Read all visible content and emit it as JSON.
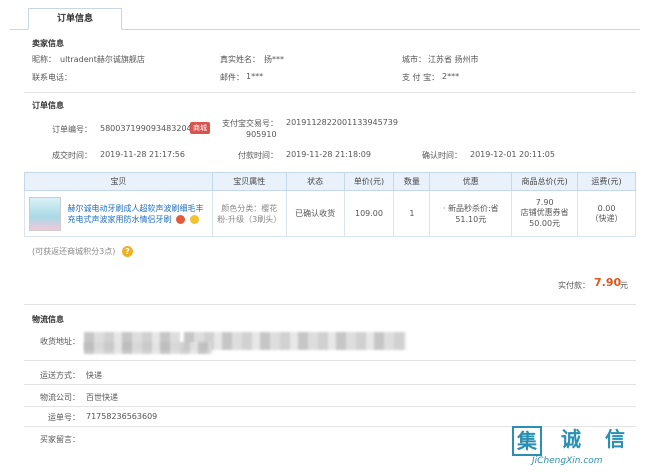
{
  "tab": {
    "label": "订单信息"
  },
  "seller": {
    "title": "卖家信息",
    "nickname_label": "昵称：",
    "nickname_value": "ultradent赫尔诚旗舰店",
    "realname_label": "真实姓名：",
    "realname_value": "扬***",
    "city_label": "城市：",
    "city_value": "江苏省 扬州市",
    "phone_label": "联系电话：",
    "phone_value": "",
    "email_label": "邮件：",
    "email_value": "1***",
    "alipay_label": "支 付 宝：",
    "alipay_value": "2***"
  },
  "order": {
    "title": "订单信息",
    "order_no_label": "订单编号：",
    "order_no_value": "580037199093483204",
    "mall_badge": "商城",
    "alipay_no_label": "支付宝交易号：",
    "alipay_no_value": "2019112822001133945739",
    "alipay_no_value2": "905910",
    "deal_time_label": "成交时间：",
    "deal_time_value": "2019-11-28 21:17:56",
    "pay_time_label": "付款时间：",
    "pay_time_value": "2019-11-28 21:18:09",
    "confirm_time_label": "确认时间：",
    "confirm_time_value": "2019-12-01 20:11:05"
  },
  "table": {
    "headers": [
      "宝贝",
      "宝贝属性",
      "状态",
      "单价(元)",
      "数量",
      "优惠",
      "商品总价(元)",
      "运费(元)"
    ],
    "row": {
      "item_name": "赫尔诚电动牙刷成人超软声波刷细毛丰充电式声波家用防水情侣牙刷",
      "attr": "颜色分类：樱花粉-升级（3刷头）",
      "status": "已确认收货",
      "price": "109.00",
      "qty": "1",
      "discount": "· 新品秒杀价:省51.10元",
      "total_line1": "7.90",
      "total_line2": "店铺优惠券省50.00元",
      "freight_line1": "0.00",
      "freight_line2": "（快递）"
    }
  },
  "points_note": "(可获返还商城积分3点)",
  "paid": {
    "label": "实付款：",
    "amount": "7.90",
    "unit": "元"
  },
  "logistics": {
    "title": "物流信息",
    "address_label": "收货地址：",
    "method_label": "运送方式：",
    "method_value": "快递",
    "company_label": "物流公司：",
    "company_value": "百世快递",
    "tracking_label": "运单号：",
    "tracking_value": "71758236563609",
    "buyer_msg_label": "买家留言：",
    "buyer_msg_value": ""
  },
  "watermark": {
    "chars": [
      "集",
      "诚",
      "信"
    ],
    "url": "JiChengXin.com"
  }
}
